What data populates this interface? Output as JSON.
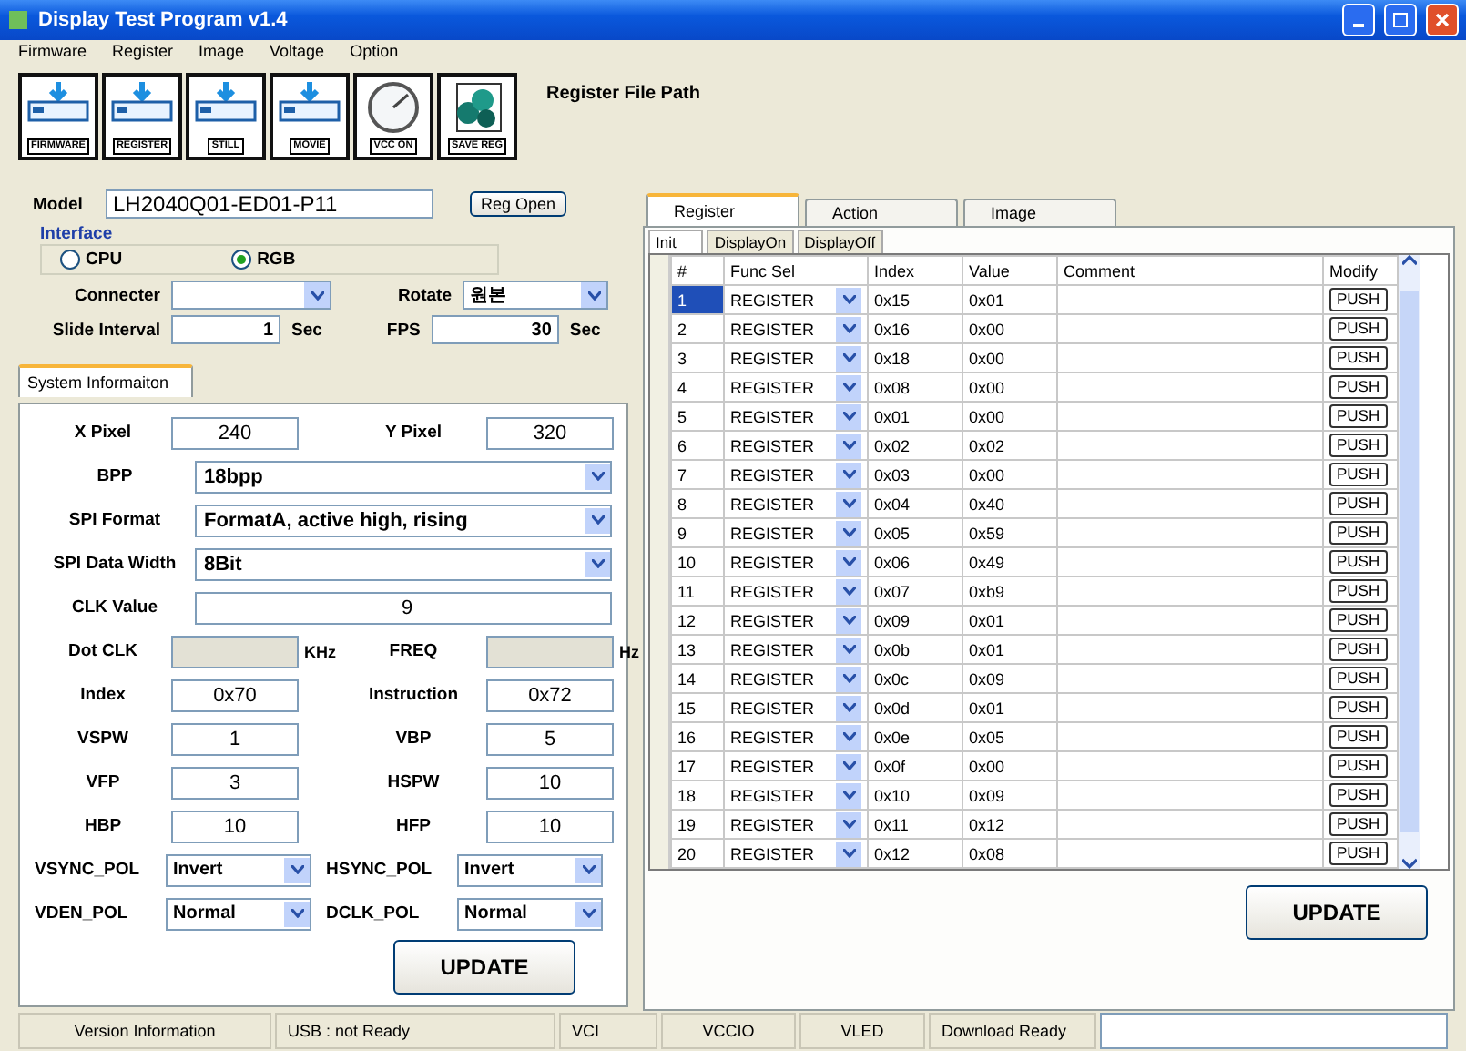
{
  "window": {
    "title": "Display Test Program v1.4"
  },
  "menu": [
    "Firmware",
    "Register",
    "Image",
    "Voltage",
    "Option"
  ],
  "toolbar": [
    {
      "label": "FIRMWARE",
      "kind": "download"
    },
    {
      "label": "REGISTER",
      "kind": "download"
    },
    {
      "label": "STILL",
      "kind": "download"
    },
    {
      "label": "MOVIE",
      "kind": "download"
    },
    {
      "label": "VCC ON",
      "kind": "gauge"
    },
    {
      "label": "SAVE REG",
      "kind": "save"
    }
  ],
  "register_file_path": "Register File Path",
  "model": {
    "label": "Model",
    "value": "LH2040Q01-ED01-P11",
    "button": "Reg Open"
  },
  "interface": {
    "label": "Interface",
    "options": [
      {
        "label": "CPU",
        "selected": false
      },
      {
        "label": "RGB",
        "selected": true
      }
    ]
  },
  "connecter": {
    "label": "Connecter"
  },
  "rotate": {
    "label": "Rotate",
    "value": "원본"
  },
  "slide_interval": {
    "label": "Slide Interval",
    "value": "1",
    "unit": "Sec"
  },
  "fps": {
    "label": "FPS",
    "value": "30",
    "unit": "Sec"
  },
  "system_tabs": [
    {
      "label": "System Informaiton",
      "selected": true
    }
  ],
  "system_info": [
    [
      {
        "label": "X Pixel",
        "value": "240",
        "kind": "field"
      },
      {
        "label": "Y Pixel",
        "value": "320",
        "kind": "field"
      }
    ],
    [
      {
        "label": "BPP",
        "value": "18bpp",
        "kind": "dropdown"
      }
    ],
    [
      {
        "label": "SPI Format",
        "value": "FormatA, active high, rising",
        "kind": "dropdown"
      }
    ],
    [
      {
        "label": "SPI Data Width",
        "value": "8Bit",
        "kind": "dropdown"
      }
    ],
    [
      {
        "label": "CLK Value",
        "value": "9",
        "kind": "field"
      }
    ],
    [
      {
        "label": "Dot CLK",
        "unit": "KHz",
        "kind": "readonly"
      },
      {
        "label": "FREQ",
        "unit": "Hz",
        "kind": "readonly"
      }
    ],
    [
      {
        "label": "Index",
        "value": "0x70",
        "kind": "field"
      },
      {
        "label": "Instruction",
        "value": "0x72",
        "kind": "field"
      }
    ],
    [
      {
        "label": "VSPW",
        "value": "1",
        "kind": "field"
      },
      {
        "label": "VBP",
        "value": "5",
        "kind": "field"
      }
    ],
    [
      {
        "label": "VFP",
        "value": "3",
        "kind": "field"
      },
      {
        "label": "HSPW",
        "value": "10",
        "kind": "field"
      }
    ],
    [
      {
        "label": "HBP",
        "value": "10",
        "kind": "field"
      },
      {
        "label": "HFP",
        "value": "10",
        "kind": "field"
      }
    ],
    [
      {
        "label": "VSYNC_POL",
        "value": "Invert",
        "kind": "dropdown"
      },
      {
        "label": "HSYNC_POL",
        "value": "Invert",
        "kind": "dropdown"
      }
    ],
    [
      {
        "label": "VDEN_POL",
        "value": "Normal",
        "kind": "dropdown"
      },
      {
        "label": "DCLK_POL",
        "value": "Normal",
        "kind": "dropdown"
      }
    ]
  ],
  "system_update_button": "UPDATE",
  "tabs": [
    {
      "label": "Register",
      "selected": true
    },
    {
      "label": "Action",
      "selected": false
    },
    {
      "label": "Image",
      "selected": false
    }
  ],
  "subtabs": [
    {
      "label": "Init",
      "selected": true
    },
    {
      "label": "DisplayOn",
      "selected": false
    },
    {
      "label": "DisplayOff",
      "selected": false
    }
  ],
  "table": {
    "columns": [
      "#",
      "Func Sel",
      "Index",
      "Value",
      "Comment",
      "Modify"
    ],
    "rows": [
      {
        "num": "1",
        "func": "REGISTER",
        "index": "0x15",
        "value": "0x01",
        "button": "PUSH",
        "selected": true
      },
      {
        "num": "2",
        "func": "REGISTER",
        "index": "0x16",
        "value": "0x00",
        "button": "PUSH",
        "selected": false
      },
      {
        "num": "3",
        "func": "REGISTER",
        "index": "0x18",
        "value": "0x00",
        "button": "PUSH",
        "selected": false
      },
      {
        "num": "4",
        "func": "REGISTER",
        "index": "0x08",
        "value": "0x00",
        "button": "PUSH",
        "selected": false
      },
      {
        "num": "5",
        "func": "REGISTER",
        "index": "0x01",
        "value": "0x00",
        "button": "PUSH",
        "selected": false
      },
      {
        "num": "6",
        "func": "REGISTER",
        "index": "0x02",
        "value": "0x02",
        "button": "PUSH",
        "selected": false
      },
      {
        "num": "7",
        "func": "REGISTER",
        "index": "0x03",
        "value": "0x00",
        "button": "PUSH",
        "selected": false
      },
      {
        "num": "8",
        "func": "REGISTER",
        "index": "0x04",
        "value": "0x40",
        "button": "PUSH",
        "selected": false
      },
      {
        "num": "9",
        "func": "REGISTER",
        "index": "0x05",
        "value": "0x59",
        "button": "PUSH",
        "selected": false
      },
      {
        "num": "10",
        "func": "REGISTER",
        "index": "0x06",
        "value": "0x49",
        "button": "PUSH",
        "selected": false
      },
      {
        "num": "11",
        "func": "REGISTER",
        "index": "0x07",
        "value": "0xb9",
        "button": "PUSH",
        "selected": false
      },
      {
        "num": "12",
        "func": "REGISTER",
        "index": "0x09",
        "value": "0x01",
        "button": "PUSH",
        "selected": false
      },
      {
        "num": "13",
        "func": "REGISTER",
        "index": "0x0b",
        "value": "0x01",
        "button": "PUSH",
        "selected": false
      },
      {
        "num": "14",
        "func": "REGISTER",
        "index": "0x0c",
        "value": "0x09",
        "button": "PUSH",
        "selected": false
      },
      {
        "num": "15",
        "func": "REGISTER",
        "index": "0x0d",
        "value": "0x01",
        "button": "PUSH",
        "selected": false
      },
      {
        "num": "16",
        "func": "REGISTER",
        "index": "0x0e",
        "value": "0x05",
        "button": "PUSH",
        "selected": false
      },
      {
        "num": "17",
        "func": "REGISTER",
        "index": "0x0f",
        "value": "0x00",
        "button": "PUSH",
        "selected": false
      },
      {
        "num": "18",
        "func": "REGISTER",
        "index": "0x10",
        "value": "0x09",
        "button": "PUSH",
        "selected": false
      },
      {
        "num": "19",
        "func": "REGISTER",
        "index": "0x11",
        "value": "0x12",
        "button": "PUSH",
        "selected": false
      },
      {
        "num": "20",
        "func": "REGISTER",
        "index": "0x12",
        "value": "0x08",
        "button": "PUSH",
        "selected": false
      }
    ]
  },
  "update_button": "UPDATE",
  "status_bar": [
    "Version Information",
    "USB : not Ready",
    "VCI",
    "VCCIO",
    "VLED",
    "Download Ready"
  ]
}
